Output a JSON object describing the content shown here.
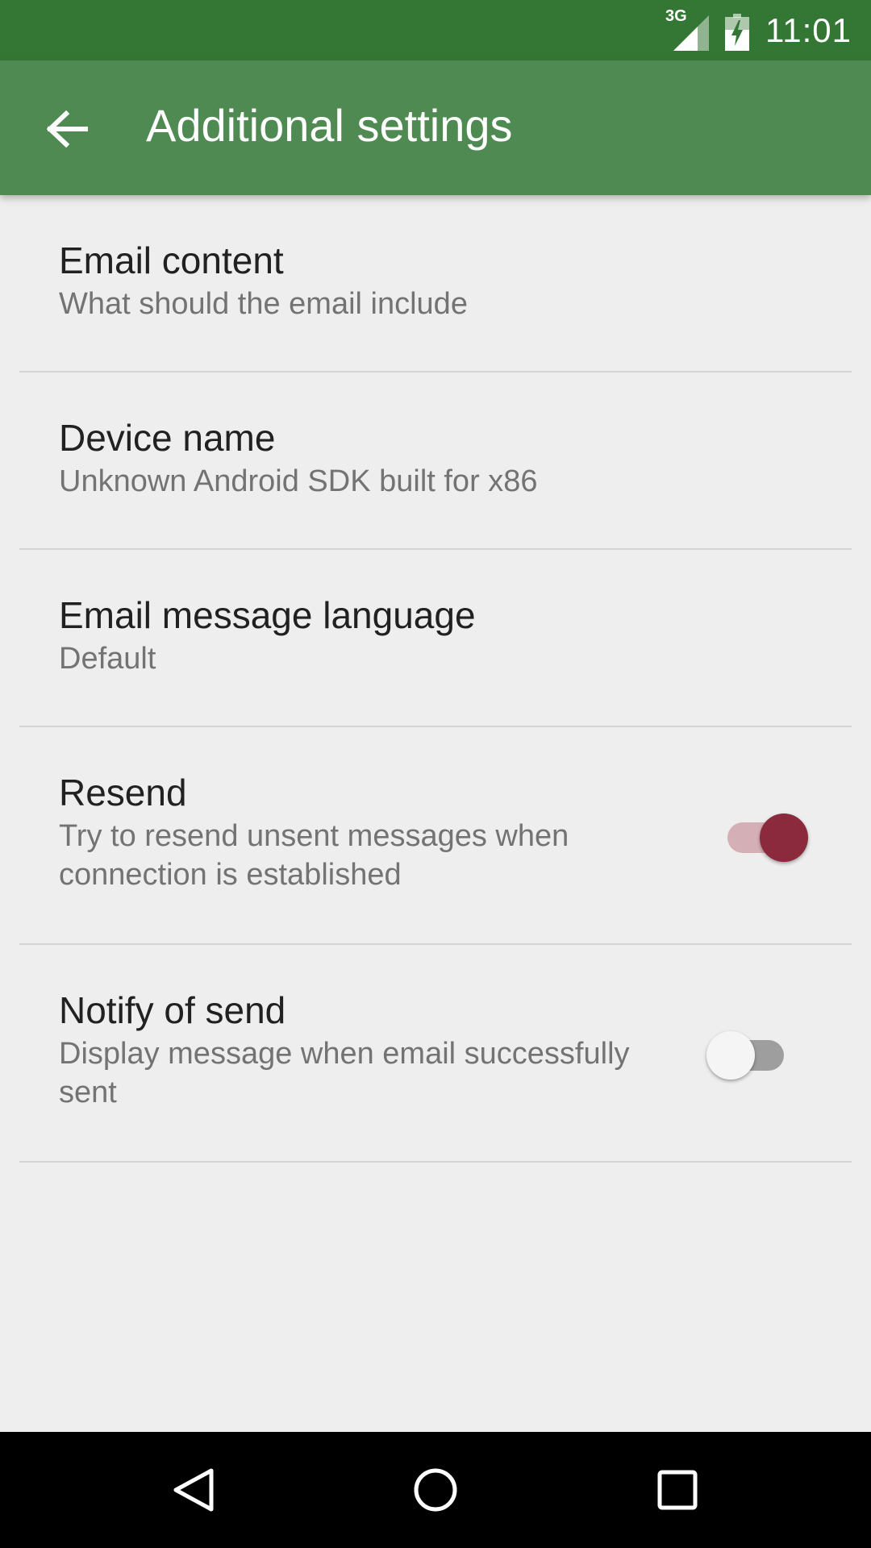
{
  "status_bar": {
    "network_type": "3G",
    "time": "11:01",
    "signal_icon": "signal-icon",
    "battery_icon": "battery-charging-icon",
    "color": "#347734"
  },
  "app_bar": {
    "title": "Additional settings",
    "back_icon": "arrow-back-icon",
    "color": "#4e8a51"
  },
  "settings": [
    {
      "title": "Email content",
      "summary": "What should the email include"
    },
    {
      "title": "Device name",
      "summary": "Unknown Android SDK built for x86"
    },
    {
      "title": "Email message language",
      "summary": "Default"
    },
    {
      "title": "Resend",
      "summary": "Try to resend unsent messages when connection is established",
      "toggle": true
    },
    {
      "title": "Notify of send",
      "summary": "Display message when email successfully sent",
      "toggle": false
    }
  ],
  "accent_color": "#8a2a3c",
  "nav_bar": {
    "back_icon": "nav-back-icon",
    "home_icon": "nav-home-icon",
    "recents_icon": "nav-recents-icon"
  }
}
